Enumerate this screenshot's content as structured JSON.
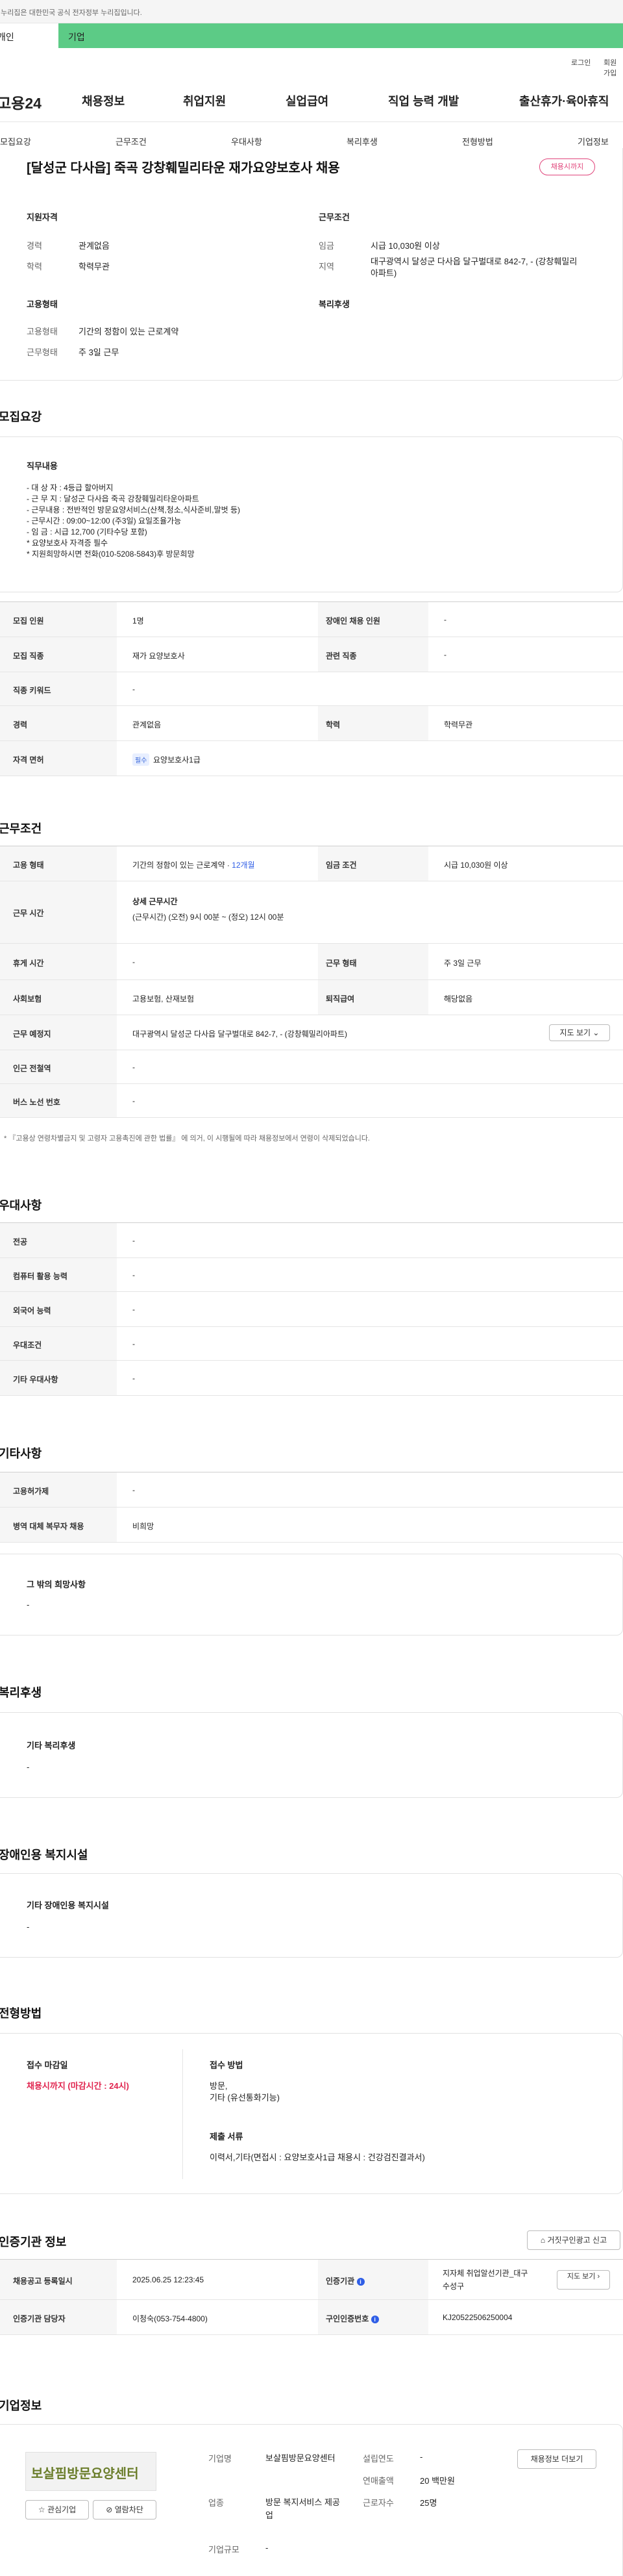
{
  "notice": "이 누리집은 대한민국 공식 전자정부 누리집입니다.",
  "service_tabs": [
    "개인",
    "기업"
  ],
  "util": {
    "login": "로그인",
    "signup": "회원가입"
  },
  "logo": "고용24",
  "gnb": [
    "채용정보",
    "취업지원",
    "실업급여",
    "직업 능력 개발",
    "출산휴가·육아휴직"
  ],
  "anchor": [
    "모집요강",
    "근무조건",
    "우대사항",
    "복리후생",
    "전형방법",
    "기업정보"
  ],
  "job": {
    "title": "[달성군 다사읍] 죽곡 강창훼밀리타운 재가요양보호사 채용",
    "status": "채용시까지",
    "qual_title": "지원자격",
    "qual": [
      {
        "k": "경력",
        "v": "관계없음"
      },
      {
        "k": "학력",
        "v": "학력무관"
      }
    ],
    "cond_title": "근무조건",
    "cond": [
      {
        "k": "임금",
        "v": "시급 10,030원 이상"
      },
      {
        "k": "지역",
        "v": "대구광역시 달성군 다사읍 달구벌대로 842-7, - (강창훼밀리아파트)"
      }
    ],
    "emp_title": "고용형태",
    "emp": [
      {
        "k": "고용형태",
        "v": "기간의 정함이 있는 근로계약"
      },
      {
        "k": "근무형태",
        "v": "주 3일 근무"
      }
    ],
    "welfare_title": "복리후생"
  },
  "recruit": {
    "title": "모집요강",
    "desc_title": "직무내용",
    "desc_lines": [
      "- 대 상 자 : 4등급 할아버지",
      "- 근 무 지 : 달성군 다사읍 죽곡 강창훼밀리타운아파트",
      "- 근무내용 : 전반적인 방문요양서비스(산책,청소,식사준비,말벗 등)",
      "- 근무시간 : 09:00~12:00 (주3일) 요일조율가능",
      "- 임       금 : 시급 12,700 (기타수당 포함)",
      "* 요양보호사 자격증 필수",
      "* 지원희망하시면 전화(010-5208-5843)후 방문희망"
    ],
    "rows": [
      {
        "k1": "모집 인원",
        "v1": "1명",
        "k2": "장애인 채용 인원",
        "v2": "-"
      },
      {
        "k1": "모집 직종",
        "v1": "재가 요양보호사",
        "k2": "관련 직종",
        "v2": "-"
      },
      {
        "k1": "직종 키워드",
        "v1": "-"
      },
      {
        "k1": "경력",
        "v1": "관계없음",
        "k2": "학력",
        "v2": "학력무관"
      },
      {
        "k1": "자격 면허",
        "tag": "필수",
        "v1": "요양보호사1급"
      }
    ]
  },
  "work": {
    "title": "근무조건",
    "emp_k": "고용 형태",
    "emp_v": "기간의 정함이 있는 근로계약 · ",
    "emp_v2": "12개월",
    "wage_k": "임금 조건",
    "wage_v": "시급 10,030원 이상",
    "time_k": "근무 시간",
    "time_h": "상세 근무시간",
    "time_v": "(근무시간) (오전) 9시 00분 ~ (정오) 12시 00분",
    "rows": [
      {
        "k1": "휴게 시간",
        "v1": "-",
        "k2": "근무 형태",
        "v2": "주 3일 근무"
      },
      {
        "k1": "사회보험",
        "v1": "고용보험, 산재보험",
        "k2": "퇴직급여",
        "v2": "해당없음"
      }
    ],
    "place_k": "근무 예정지",
    "place_v": "대구광역시 달성군 다사읍 달구벌대로 842-7, - (강창훼밀리아파트)",
    "map_btn": "지도 보기",
    "station_k": "인근 전철역",
    "station_v": "-",
    "bus_k": "버스 노선 번호",
    "bus_v": "-",
    "note": "* 『고용상 연령차별금지 및 고령자 고용촉진에 관한 법률』 에 의거, 이 시행될에 따라 채용정보에서 연령이 삭제되었습니다."
  },
  "pref": {
    "title": "우대사항",
    "rows": [
      {
        "k": "전공",
        "v": "-"
      },
      {
        "k": "컴퓨터 활용 능력",
        "v": "-"
      },
      {
        "k": "외국어 능력",
        "v": "-"
      },
      {
        "k": "우대조건",
        "v": "-"
      },
      {
        "k": "기타 우대사항",
        "v": "-"
      }
    ]
  },
  "etc": {
    "title": "기타사항",
    "rows": [
      {
        "k": "고용허가제",
        "v": "-"
      },
      {
        "k": "병역 대체 복무자 채용",
        "v": "비희망"
      }
    ],
    "box_title": "그 밖의 희망사항",
    "box_v": "-"
  },
  "benefit": {
    "title": "복리후생",
    "box_title": "기타 복리후생",
    "box_v": "-"
  },
  "disabled": {
    "title": "장애인용 복지시설",
    "box_title": "기타 장애인용 복지시설",
    "box_v": "-"
  },
  "process": {
    "title": "전형방법",
    "deadline_k": "접수 마감일",
    "deadline_v": "채용시까지 (마감시간 : 24시)",
    "method_k": "접수 방법",
    "method_v1": "방문,",
    "method_v2": "기타 (유선통화기능)",
    "docs_k": "제출 서류",
    "docs_v": "이력서,기타(면접시 : 요양보호사1급 채용시 : 건강검진결과서)"
  },
  "cert": {
    "title": "인증기관 정보",
    "report_btn": "거짓구인광고 신고",
    "reg_k": "채용공고 등록일시",
    "reg_v": "2025.06.25 12:23:45",
    "org_k": "인증기관",
    "org_v1": "지자체 취업알선기관_대구",
    "org_v2": "수성구",
    "view_btn": "지도 보기",
    "mgr_k": "인증기관 담당자",
    "mgr_v": "이청숙(053-754-4800)",
    "no_k": "구인인증번호",
    "no_v": "KJ20522506250004"
  },
  "company": {
    "title": "기업정보",
    "logo_text": "보살핌방문요양센터",
    "fav_btn": "관심기업",
    "block_btn": "열람차단",
    "info_btn": "채용정보 더보기",
    "name_k": "기업명",
    "name_v": "보살핌방문요양센터",
    "industry_k": "업종",
    "industry_v": "방문 복지서비스 제공업",
    "size_k": "기업규모",
    "size_v": "-",
    "year_k": "설립연도",
    "year_v": "-",
    "sales_k": "연매출액",
    "sales_v": "20 백만원",
    "emp_k": "근로자수",
    "emp_v": "25명"
  }
}
